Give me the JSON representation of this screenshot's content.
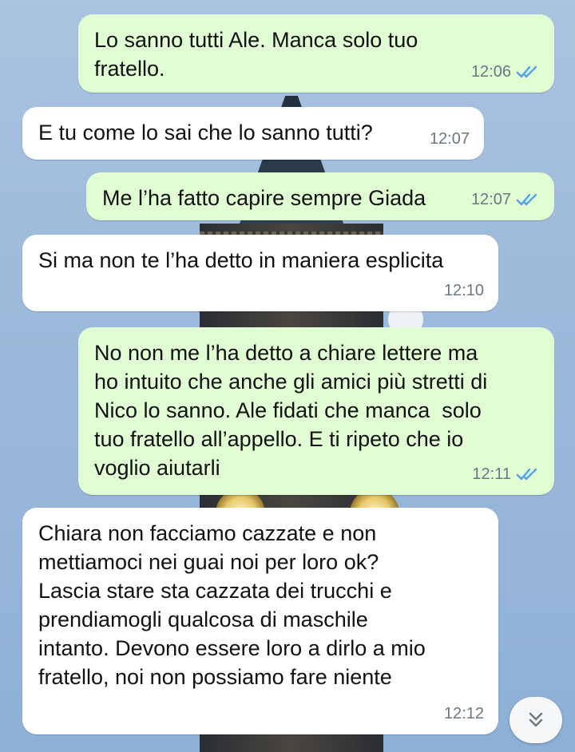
{
  "messages": [
    {
      "direction": "out",
      "text": "Lo sanno tutti Ale. Manca solo tuo\nfratello.",
      "time": "12:06",
      "read": true
    },
    {
      "direction": "in",
      "text": "E tu come lo sai che lo sanno tutti?",
      "time": "12:07"
    },
    {
      "direction": "out",
      "text": "Me l’ha fatto capire sempre Giada",
      "time": "12:07",
      "read": true
    },
    {
      "direction": "in",
      "text": "Si ma non te l’ha detto in maniera esplicita",
      "time": "12:10"
    },
    {
      "direction": "out",
      "text": "No non me l’ha detto a chiare lettere ma\nho intuito che anche gli amici più stretti di\nNico lo sanno. Ale fidati che manca  solo\ntuo fratello all’appello. E ti ripeto che io\nvoglio aiutarli",
      "time": "12:11",
      "read": true
    },
    {
      "direction": "in",
      "text": "Chiara non facciamo cazzate e non\nmettiamoci nei guai noi per loro ok?\nLascia stare sta cazzata dei trucchi e\nprendiamogli qualcosa di maschile\nintanto. Devono essere loro a dirlo a mio\nfratello, noi non possiamo fare niente",
      "time": "12:12"
    }
  ],
  "colors": {
    "outgoing_bubble": "#e1fdd3",
    "incoming_bubble": "#ffffff",
    "read_ticks": "#4fa3e8"
  },
  "scroll_button": {
    "icon": "double-chevron-down-icon"
  }
}
